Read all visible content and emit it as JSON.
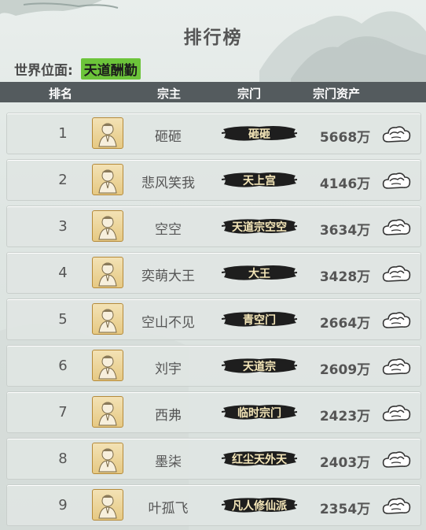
{
  "title": "排行榜",
  "world_rank": {
    "label": "世界位面:",
    "value": "天道酬勤"
  },
  "columns": {
    "rank": "排名",
    "leader": "宗主",
    "sect": "宗门",
    "assets": "宗门资产"
  },
  "rows": [
    {
      "rank": "1",
      "leader": "砸砸",
      "sect": "砸砸",
      "assets": "5668万"
    },
    {
      "rank": "2",
      "leader": "悲风笑我",
      "sect": "天上宫",
      "assets": "4146万"
    },
    {
      "rank": "3",
      "leader": "空空",
      "sect": "天道宗空空",
      "assets": "3634万"
    },
    {
      "rank": "4",
      "leader": "奕萌大王",
      "sect": "大王",
      "assets": "3428万"
    },
    {
      "rank": "5",
      "leader": "空山不见",
      "sect": "青空门",
      "assets": "2664万"
    },
    {
      "rank": "6",
      "leader": "刘宇",
      "sect": "天道宗",
      "assets": "2609万"
    },
    {
      "rank": "7",
      "leader": "西弗",
      "sect": "临时宗门",
      "assets": "2423万"
    },
    {
      "rank": "8",
      "leader": "墨柒",
      "sect": "红尘天外天",
      "assets": "2403万"
    },
    {
      "rank": "9",
      "leader": "叶孤飞",
      "sect": "凡人修仙派",
      "assets": "2354万"
    }
  ],
  "icons": {
    "avatar": "monk-portrait-icon",
    "view": "cloud-visit-icon"
  },
  "colors": {
    "header_bg": "#545b5e",
    "world_value_bg": "#6cc43a",
    "sect_label": "#f4e6b8"
  }
}
